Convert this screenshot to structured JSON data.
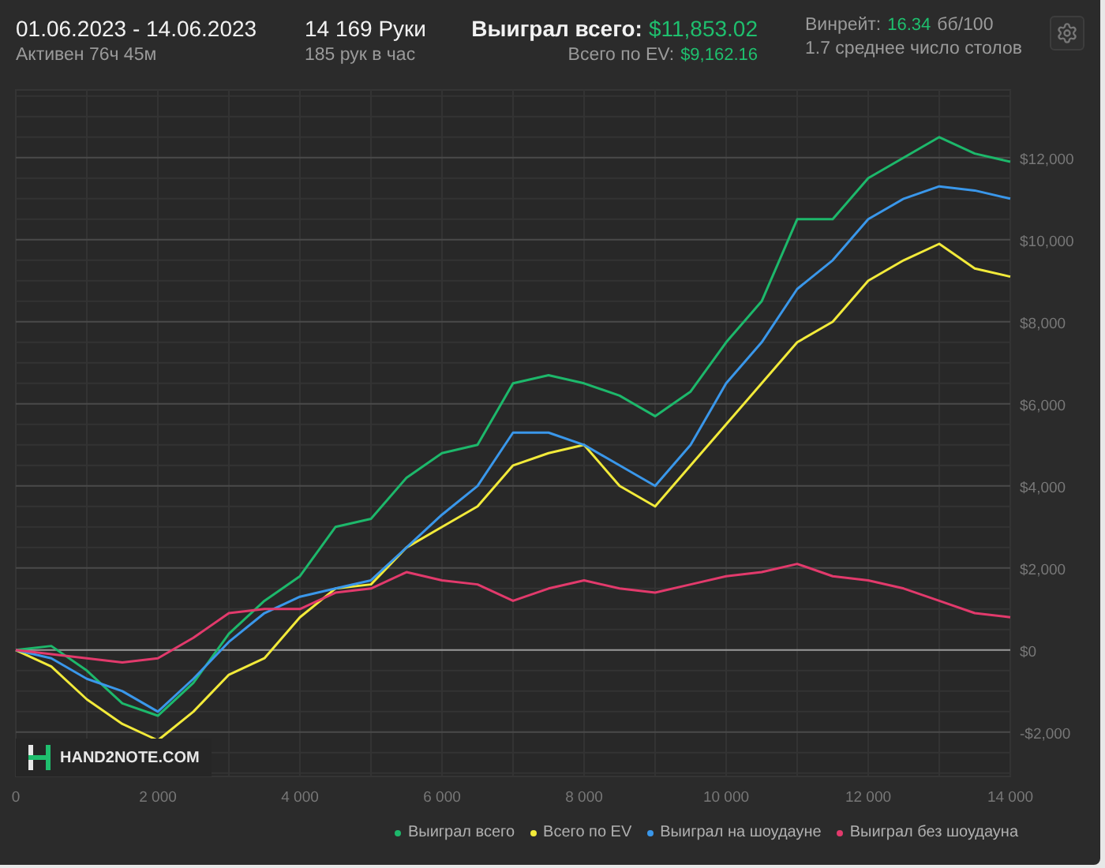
{
  "header": {
    "date_range": "01.06.2023 - 14.06.2023",
    "active_time": "Активен 76ч 45м",
    "hands": "14 169 Руки",
    "hands_per_hour": "185 рук в час",
    "won_total": {
      "label": "Выиграл всего:",
      "value": "$11,853.02"
    },
    "ev_total": {
      "label": "Всего по EV:",
      "value": "$9,162.16"
    },
    "winrate": {
      "label": "Винрейт:",
      "value": "16.34",
      "unit": "бб/100"
    },
    "avg_tables": "1.7 среднее число столов"
  },
  "chart": {
    "logo": "HAND2NOTE.COM",
    "chart_data": {
      "type": "line",
      "grid": true,
      "x": [
        0,
        500,
        1000,
        1500,
        2000,
        2500,
        3000,
        3500,
        4000,
        4500,
        5000,
        5500,
        6000,
        6500,
        7000,
        7500,
        8000,
        8500,
        9000,
        9500,
        10000,
        10500,
        11000,
        11500,
        12000,
        12500,
        13000,
        13500,
        14000
      ],
      "xlim": [
        0,
        14000
      ],
      "ylim": [
        -3080,
        13650
      ],
      "xticks": [
        {
          "value": 0,
          "label": "0"
        },
        {
          "value": 2000,
          "label": "2 000"
        },
        {
          "value": 4000,
          "label": "4 000"
        },
        {
          "value": 6000,
          "label": "6 000"
        },
        {
          "value": 8000,
          "label": "8 000"
        },
        {
          "value": 10000,
          "label": "10 000"
        },
        {
          "value": 12000,
          "label": "12 000"
        },
        {
          "value": 14000,
          "label": "14 000"
        }
      ],
      "yticks": [
        {
          "value": -2000,
          "label": "-$2,000"
        },
        {
          "value": 0,
          "label": "$0"
        },
        {
          "value": 2000,
          "label": "$2,000"
        },
        {
          "value": 4000,
          "label": "$4,000"
        },
        {
          "value": 6000,
          "label": "$6,000"
        },
        {
          "value": 8000,
          "label": "$8,000"
        },
        {
          "value": 10000,
          "label": "$10,000"
        },
        {
          "value": 12000,
          "label": "$12,000"
        }
      ],
      "series": [
        {
          "name": "Выиграл всего",
          "color": "#1db86b",
          "values": [
            0,
            100,
            -500,
            -1300,
            -1600,
            -800,
            400,
            1200,
            1800,
            3000,
            3200,
            4200,
            4800,
            5000,
            6500,
            6700,
            6500,
            6200,
            5700,
            6300,
            7500,
            8500,
            10500,
            10500,
            11500,
            12000,
            12500,
            12100,
            11900
          ]
        },
        {
          "name": "Всего по EV",
          "color": "#f2ea3a",
          "values": [
            0,
            -400,
            -1200,
            -1800,
            -2200,
            -1500,
            -600,
            -200,
            800,
            1500,
            1600,
            2500,
            3000,
            3500,
            4500,
            4800,
            5000,
            4000,
            3500,
            4500,
            5500,
            6500,
            7500,
            8000,
            9000,
            9500,
            9900,
            9300,
            9100
          ]
        },
        {
          "name": "Выиграл на шоудауне",
          "color": "#3a97ea",
          "values": [
            0,
            -200,
            -700,
            -1000,
            -1500,
            -700,
            200,
            900,
            1300,
            1500,
            1700,
            2500,
            3300,
            4000,
            5300,
            5300,
            5000,
            4500,
            4000,
            5000,
            6500,
            7500,
            8800,
            9500,
            10500,
            11000,
            11300,
            11200,
            11000
          ]
        },
        {
          "name": "Выиграл без шоудауна",
          "color": "#e23a6c",
          "values": [
            0,
            -100,
            -200,
            -300,
            -200,
            300,
            900,
            1000,
            1000,
            1400,
            1500,
            1900,
            1700,
            1600,
            1200,
            1500,
            1700,
            1500,
            1400,
            1600,
            1800,
            1900,
            2100,
            1800,
            1700,
            1500,
            1200,
            900,
            800
          ]
        }
      ]
    }
  }
}
